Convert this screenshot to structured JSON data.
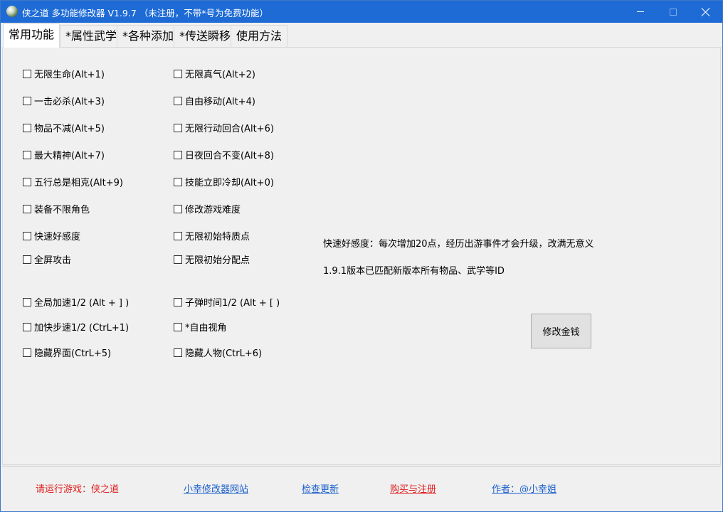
{
  "window": {
    "title": "侠之道 多功能修改器  V1.9.7 （未注册，不带*号为免费功能）"
  },
  "tabs": [
    {
      "label": "常用功能",
      "active": true
    },
    {
      "label": "*属性武学",
      "active": false
    },
    {
      "label": "*各种添加",
      "active": false
    },
    {
      "label": "*传送瞬移",
      "active": false
    },
    {
      "label": "使用方法",
      "active": false
    }
  ],
  "checkboxes": {
    "left": [
      {
        "label": "无限生命(Alt+1)",
        "checked": false
      },
      {
        "label": "一击必杀(Alt+3)",
        "checked": false
      },
      {
        "label": "物品不减(Alt+5)",
        "checked": false
      },
      {
        "label": "最大精神(Alt+7)",
        "checked": false
      },
      {
        "label": "五行总是相克(Alt+9)",
        "checked": false
      },
      {
        "label": "装备不限角色",
        "checked": false
      },
      {
        "label": "快速好感度",
        "checked": false
      },
      {
        "label": "全屏攻击",
        "checked": false
      },
      {
        "label": "全局加速1/2 (Alt + ] )",
        "checked": false
      },
      {
        "label": "加快步速1/2 (CtrL+1)",
        "checked": false
      },
      {
        "label": "隐藏界面(CtrL+5)",
        "checked": false
      }
    ],
    "right": [
      {
        "label": "无限真气(Alt+2)",
        "checked": false
      },
      {
        "label": "自由移动(Alt+4)",
        "checked": false
      },
      {
        "label": "无限行动回合(Alt+6)",
        "checked": false
      },
      {
        "label": "日夜回合不变(Alt+8)",
        "checked": false
      },
      {
        "label": "技能立即冷却(Alt+0)",
        "checked": false
      },
      {
        "label": "修改游戏难度",
        "checked": false
      },
      {
        "label": "无限初始特质点",
        "checked": false
      },
      {
        "label": "无限初始分配点",
        "checked": false
      },
      {
        "label": "子弹时间1/2 (Alt + [ )",
        "checked": false
      },
      {
        "label": "*自由视角",
        "checked": false
      },
      {
        "label": "隐藏人物(CtrL+6)",
        "checked": false
      }
    ]
  },
  "info": {
    "line1": "快速好感度：每次增加20点，经历出游事件才会升级，改满无意义",
    "line2": "1.9.1版本已匹配新版本所有物品、武学等ID"
  },
  "buttons": {
    "modify_gold": "修改金钱"
  },
  "footer": {
    "run_game": "请运行游戏：侠之道",
    "website": "小幸修改器网站",
    "check_update": "检查更新",
    "buy_register": "购买与注册",
    "author": "作者：@小幸姐"
  }
}
